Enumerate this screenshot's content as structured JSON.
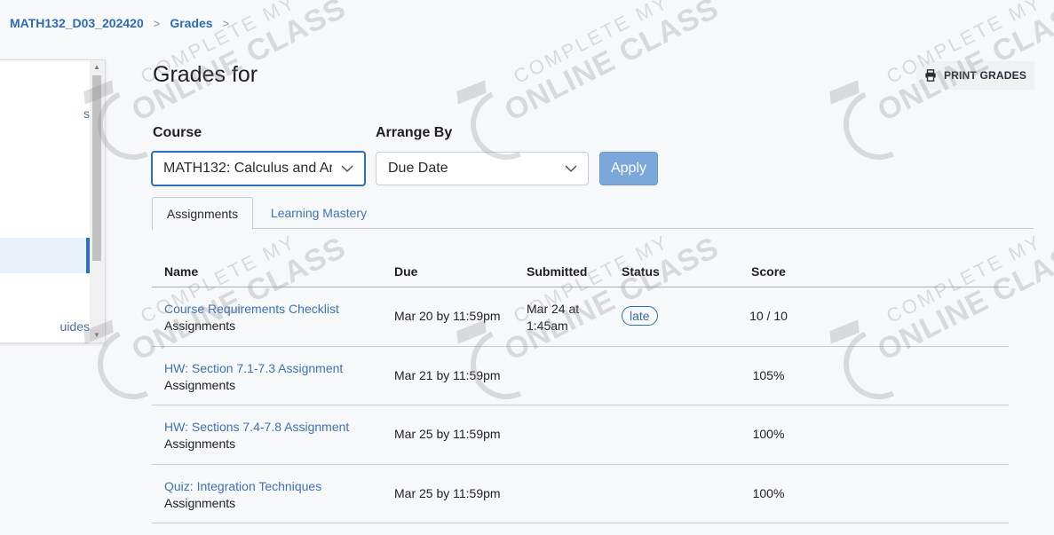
{
  "breadcrumb": {
    "items": [
      "MATH132_D03_202420",
      "Grades"
    ],
    "separator": ">"
  },
  "sidebar": {
    "items": [
      {
        "label": "s",
        "active": false
      },
      {
        "label": "",
        "active": true
      },
      {
        "label": "uides",
        "active": false
      }
    ],
    "active_indicator_color": "#2870d0"
  },
  "header": {
    "title": "Grades for",
    "print_button": "PRINT GRADES",
    "print_icon": "printer-icon"
  },
  "filters": {
    "course_label": "Course",
    "course_value": "MATH132: Calculus and Ar",
    "arrange_label": "Arrange By",
    "arrange_value": "Due Date",
    "apply_label": "Apply"
  },
  "tabs": [
    {
      "label": "Assignments",
      "active": true
    },
    {
      "label": "Learning Mastery",
      "active": false
    }
  ],
  "table": {
    "columns": [
      "Name",
      "Due",
      "Submitted",
      "Status",
      "Score"
    ],
    "rows": [
      {
        "name": "Course Requirements Checklist",
        "group": "Assignments",
        "due": "Mar 20 by 11:59pm",
        "submitted": "Mar 24 at 1:45am",
        "status": "late",
        "score": "10 / 10"
      },
      {
        "name": "HW: Section 7.1-7.3 Assignment",
        "group": "Assignments",
        "due": "Mar 21 by 11:59pm",
        "submitted": "",
        "status": "",
        "score": "105%"
      },
      {
        "name": "HW: Sections 7.4-7.8 Assignment",
        "group": "Assignments",
        "due": "Mar 25 by 11:59pm",
        "submitted": "",
        "status": "",
        "score": "100%"
      },
      {
        "name": "Quiz: Integration Techniques",
        "group": "Assignments",
        "due": "Mar 25 by 11:59pm",
        "submitted": "",
        "status": "",
        "score": "100%"
      }
    ]
  },
  "watermark": {
    "line1": "COMPLETE MY",
    "line2": "ONLINE CLASS"
  },
  "colors": {
    "link": "#3c72b8",
    "primary": "#2b6fb6",
    "apply_disabled": "#7ba7db",
    "background": "#f7f8fa"
  }
}
